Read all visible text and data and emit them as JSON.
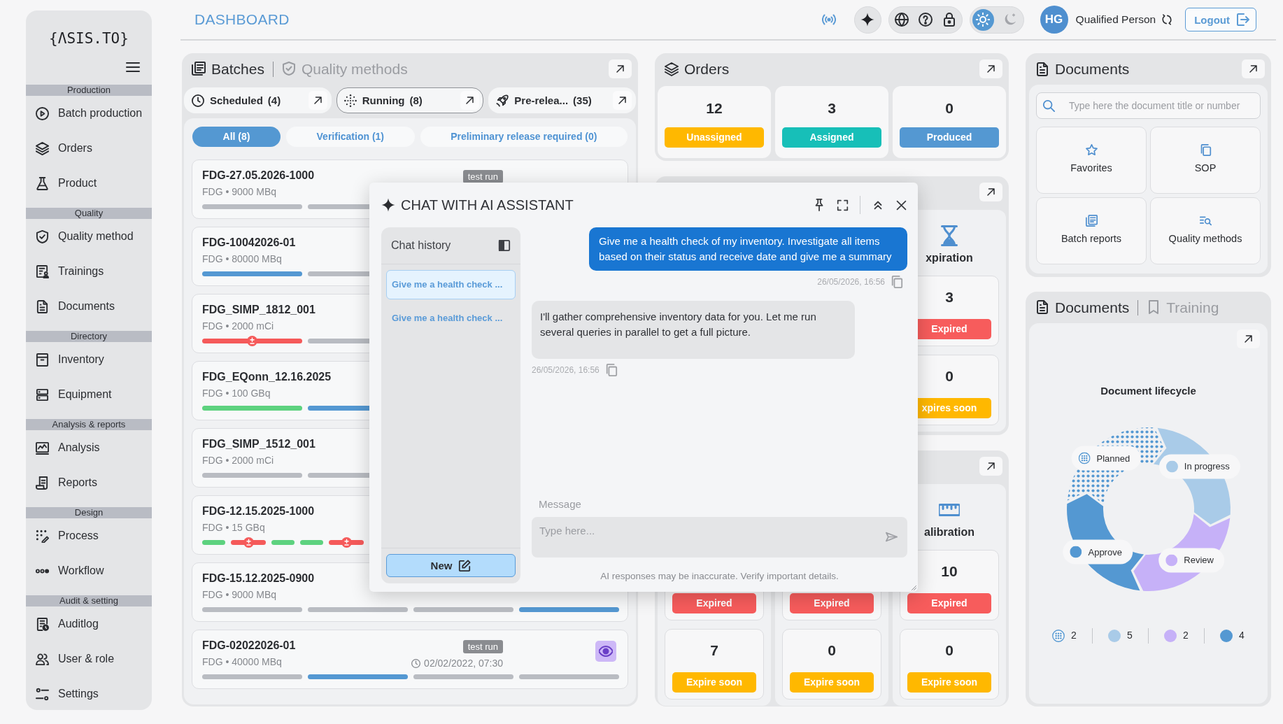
{
  "sidebar": {
    "logo": "{ΛSIS.TO}",
    "sections": [
      {
        "title": "Production",
        "items": [
          {
            "label": "Batch production"
          },
          {
            "label": "Orders"
          },
          {
            "label": "Product"
          }
        ]
      },
      {
        "title": "Quality",
        "items": [
          {
            "label": "Quality method"
          },
          {
            "label": "Trainings"
          },
          {
            "label": "Documents"
          }
        ]
      },
      {
        "title": "Directory",
        "items": [
          {
            "label": "Inventory"
          },
          {
            "label": "Equipment"
          }
        ]
      },
      {
        "title": "Analysis & reports",
        "items": [
          {
            "label": "Analysis"
          },
          {
            "label": "Reports"
          }
        ]
      },
      {
        "title": "Design",
        "items": [
          {
            "label": "Process"
          },
          {
            "label": "Workflow"
          }
        ]
      },
      {
        "title": "Audit & setting",
        "items": [
          {
            "label": "Auditlog"
          },
          {
            "label": "User & role"
          },
          {
            "label": "Settings"
          }
        ]
      }
    ]
  },
  "header": {
    "title": "DASHBOARD",
    "theme": [
      {
        "kind": "light",
        "selected": true
      },
      {
        "kind": "dark",
        "selected": false
      }
    ],
    "user": {
      "initials": "HG",
      "role": "Qualified Person"
    },
    "logout": "Logout"
  },
  "batches": {
    "tabs": [
      {
        "label": "Batches",
        "selected": true
      },
      {
        "label": "Quality methods",
        "selected": false
      }
    ],
    "status_tabs": [
      {
        "label": "Scheduled",
        "count": "(4)",
        "selected": false
      },
      {
        "label": "Running",
        "count": "(8)",
        "selected": true
      },
      {
        "label": "Pre-relea...",
        "count": "(35)",
        "selected": false
      }
    ],
    "filters": [
      {
        "label": "All (8)",
        "selected": true
      },
      {
        "label": "Verification (1)",
        "selected": false
      },
      {
        "label": "Preliminary release required (0)",
        "selected": false
      }
    ],
    "cards": [
      {
        "name": "FDG-27.05.2026-1000",
        "details": "FDG • 9000 MBq",
        "badge": "test run",
        "kind": "coarse",
        "segments": [
          {
            "color": "#b9bcc2",
            "flag": false
          },
          {
            "color": "#b9bcc2",
            "flag": false
          }
        ]
      },
      {
        "name": "FDG-10042026-01",
        "details": "FDG • 80000 MBq",
        "kind": "coarse",
        "segments": [
          {
            "color": "#5498d2",
            "flag": false
          },
          {
            "color": "#b9bcc2",
            "flag": false
          }
        ]
      },
      {
        "name": "FDG_SIMP_1812_001",
        "details": "FDG • 2000 mCi",
        "kind": "coarse",
        "segments": [
          {
            "color": "#f55a5a",
            "flag": true
          },
          {
            "color": "#b9bcc2",
            "flag": false
          }
        ]
      },
      {
        "name": "FDG_EQonn_12.16.2025",
        "details": "FDG • 100 GBq",
        "kind": "coarse",
        "segments": [
          {
            "color": "#5dd27f",
            "flag": false
          },
          {
            "color": "#5498d2",
            "flag": false
          }
        ]
      },
      {
        "name": "FDG_SIMP_1512_001",
        "details": "FDG • 2000 mCi",
        "kind": "coarse",
        "segments": [
          {
            "color": "#b9bcc2",
            "flag": false
          },
          {
            "color": "#b9bcc2",
            "flag": false
          }
        ]
      },
      {
        "name": "FDG-12.15.2025-1000",
        "details": "FDG • 15 GBq",
        "kind": "fine",
        "segments": [
          {
            "color": "#5dd27f",
            "flag": false
          },
          {
            "color": "#f55a5a",
            "flag": true
          },
          {
            "color": "#5dd27f",
            "flag": false
          },
          {
            "color": "#5dd27f",
            "flag": false
          },
          {
            "color": "#f55a5a",
            "flag": true
          }
        ]
      },
      {
        "name": "FDG-15.12.2025-0900",
        "details": "FDG • 9000 MBq",
        "kind": "coarse",
        "segments": [
          {
            "color": "#b9bcc2",
            "flag": false
          },
          {
            "color": "#b9bcc2",
            "flag": false
          },
          {
            "color": "#b9bcc2",
            "flag": false
          },
          {
            "color": "#5498d2",
            "flag": false
          }
        ]
      },
      {
        "name": "FDG-02022026-01",
        "details": "FDG • 40000 MBq",
        "badge": "test run",
        "time": "02/02/2022, 07:30",
        "viewable": true,
        "kind": "coarse",
        "segments": [
          {
            "color": "#b9bcc2",
            "flag": false
          },
          {
            "color": "#5498d2",
            "flag": false
          },
          {
            "color": "#b9bcc2",
            "flag": false
          },
          {
            "color": "#b9bcc2",
            "flag": false
          }
        ]
      }
    ]
  },
  "orders": {
    "title": "Orders",
    "stats": [
      {
        "count": "12",
        "label": "Unassigned",
        "color": "#ffb800"
      },
      {
        "count": "3",
        "label": "Assigned",
        "color": "#17bfb8"
      },
      {
        "count": "0",
        "label": "Produced",
        "color": "#5498d2"
      }
    ]
  },
  "inventory_panels": [
    {
      "columns": [
        {
          "kind": "expiration",
          "title": "xpiration",
          "cards": [
            {
              "count": "3",
              "label": "Expired",
              "color": "#f75c5c"
            },
            {
              "count": "0",
              "label": "xpires soon",
              "color": "#ffb800"
            }
          ]
        }
      ]
    },
    {
      "columns": [
        {
          "cards": [
            {
              "label": "Expired",
              "color": "#f75c5c"
            },
            {
              "count": "7",
              "label": "Expire soon",
              "color": "#ffb800"
            }
          ]
        },
        {
          "cards": [
            {
              "label": "Expired",
              "color": "#f75c5c"
            },
            {
              "count": "0",
              "label": "Expire soon",
              "color": "#ffb800"
            }
          ]
        },
        {
          "kind": "calibration",
          "title": "alibration",
          "cards": [
            {
              "count": "10",
              "label": "Expired",
              "color": "#f75c5c"
            },
            {
              "count": "0",
              "label": "Expire soon",
              "color": "#ffb800"
            }
          ]
        }
      ]
    }
  ],
  "documents": {
    "title": "Documents",
    "search": {
      "placeholder": "Type here the document title or number"
    },
    "tiles": [
      {
        "label": "Favorites"
      },
      {
        "label": "SOP"
      },
      {
        "label": "Batch reports"
      },
      {
        "label": "Quality methods"
      }
    ]
  },
  "lifecycle": {
    "tabs": [
      {
        "label": "Documents",
        "selected": true
      },
      {
        "label": "Training",
        "selected": false
      }
    ],
    "title": "Document lifecycle",
    "stages": [
      {
        "label": "Planned",
        "count": "2",
        "color": "#5498d2",
        "kind": "dotted"
      },
      {
        "label": "In progress",
        "count": "5",
        "color": "#a9cbe8",
        "kind": "solid"
      },
      {
        "label": "Review",
        "count": "2",
        "color": "#c6b1f8",
        "kind": "solid"
      },
      {
        "label": "Approve",
        "count": "4",
        "color": "#5498d2",
        "kind": "solid"
      }
    ]
  },
  "chat": {
    "title": "CHAT WITH AI ASSISTANT",
    "history": {
      "title": "Chat history",
      "items": [
        {
          "label": "Give me a health check ...",
          "selected": true
        },
        {
          "label": "Give me a health check ...",
          "selected": false
        }
      ],
      "new_label": "New"
    },
    "messages": [
      {
        "kind": "user",
        "text": "Give me a health check of my inventory. Investigate all items based on their status and receive date and give me a summary",
        "time": "26/05/2026, 16:56"
      },
      {
        "kind": "assistant",
        "text": "I'll gather comprehensive inventory data for you. Let me run several queries in parallel to get a full picture.",
        "time": "26/05/2026, 16:56"
      }
    ],
    "composer": {
      "label": "Message",
      "placeholder": "Type here..."
    },
    "disclaimer": "AI responses may be inaccurate. Verify important details."
  }
}
